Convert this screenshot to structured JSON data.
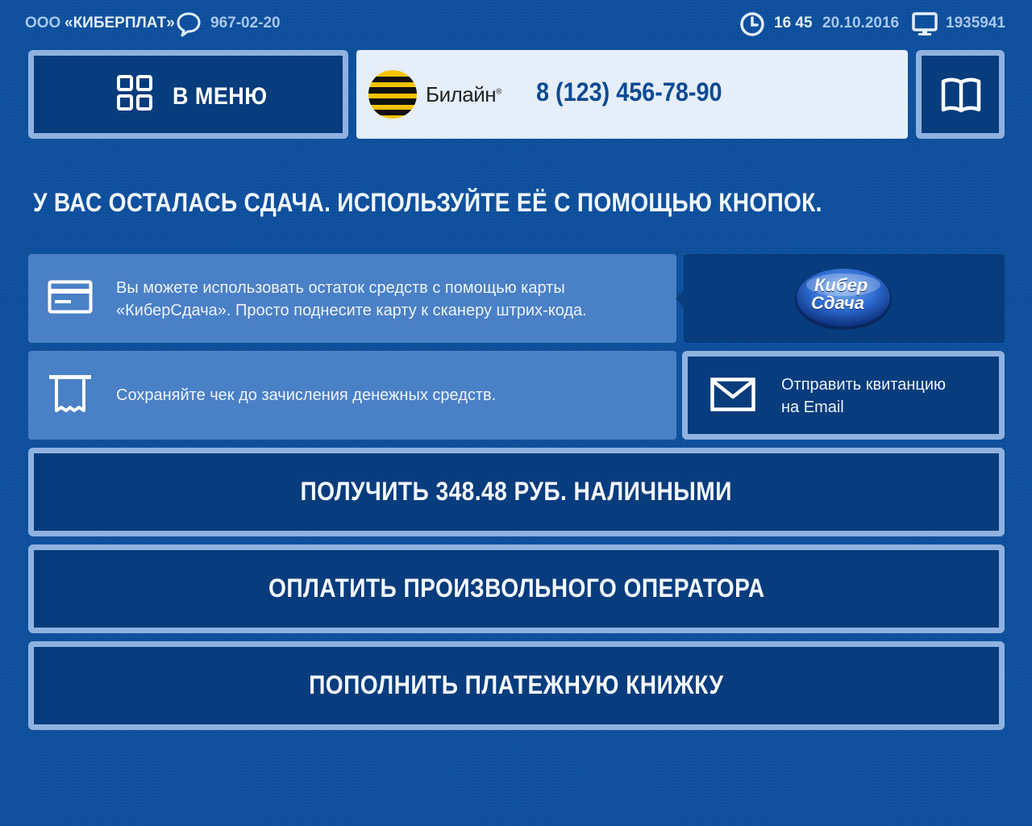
{
  "header": {
    "company_prefix": "ООО",
    "company_name": "«КИБЕРПЛАТ»",
    "support_phone": "967-02-20",
    "time": "16 45",
    "date": "20.10.2016",
    "terminal_id": "1935941"
  },
  "nav": {
    "menu_label": "В МЕНЮ"
  },
  "operator": {
    "brand": "Билайн",
    "phone": "8 (123) 456-78-90",
    "logo_colors": [
      "#f5c400",
      "#111111"
    ]
  },
  "headline": "У ВАС ОСТАЛАСЬ СДАЧА. ИСПОЛЬЗУЙТЕ ЕЁ С ПОМОЩЬЮ КНОПОК.",
  "info_card": {
    "line1": "Вы можете использовать остаток средств с помощью карты",
    "line2": "«КиберСдача». Просто поднесите карту к сканеру штрих-кода.",
    "logo_text_1": "Кибер",
    "logo_text_2": "Сдача"
  },
  "info_receipt": {
    "text": "Сохраняйте чек до зачисления денежных средств."
  },
  "email": {
    "line1": "Отправить квитанцию",
    "line2": "на Email"
  },
  "actions": {
    "cash_label": "ПОЛУЧИТЬ 348.48 РУБ. НАЛИЧНЫМИ",
    "operator_label": "ОПЛАТИТЬ ПРОИЗВОЛЬНОГО ОПЕРАТОРА",
    "book_label": "ПОПОЛНИТЬ ПЛАТЕЖНУЮ КНИЖКУ"
  },
  "colors": {
    "background": "#0d4f9c",
    "button_fill": "#073c7d",
    "button_border": "#8fb2e0",
    "info_fill": "#4a80c6"
  }
}
